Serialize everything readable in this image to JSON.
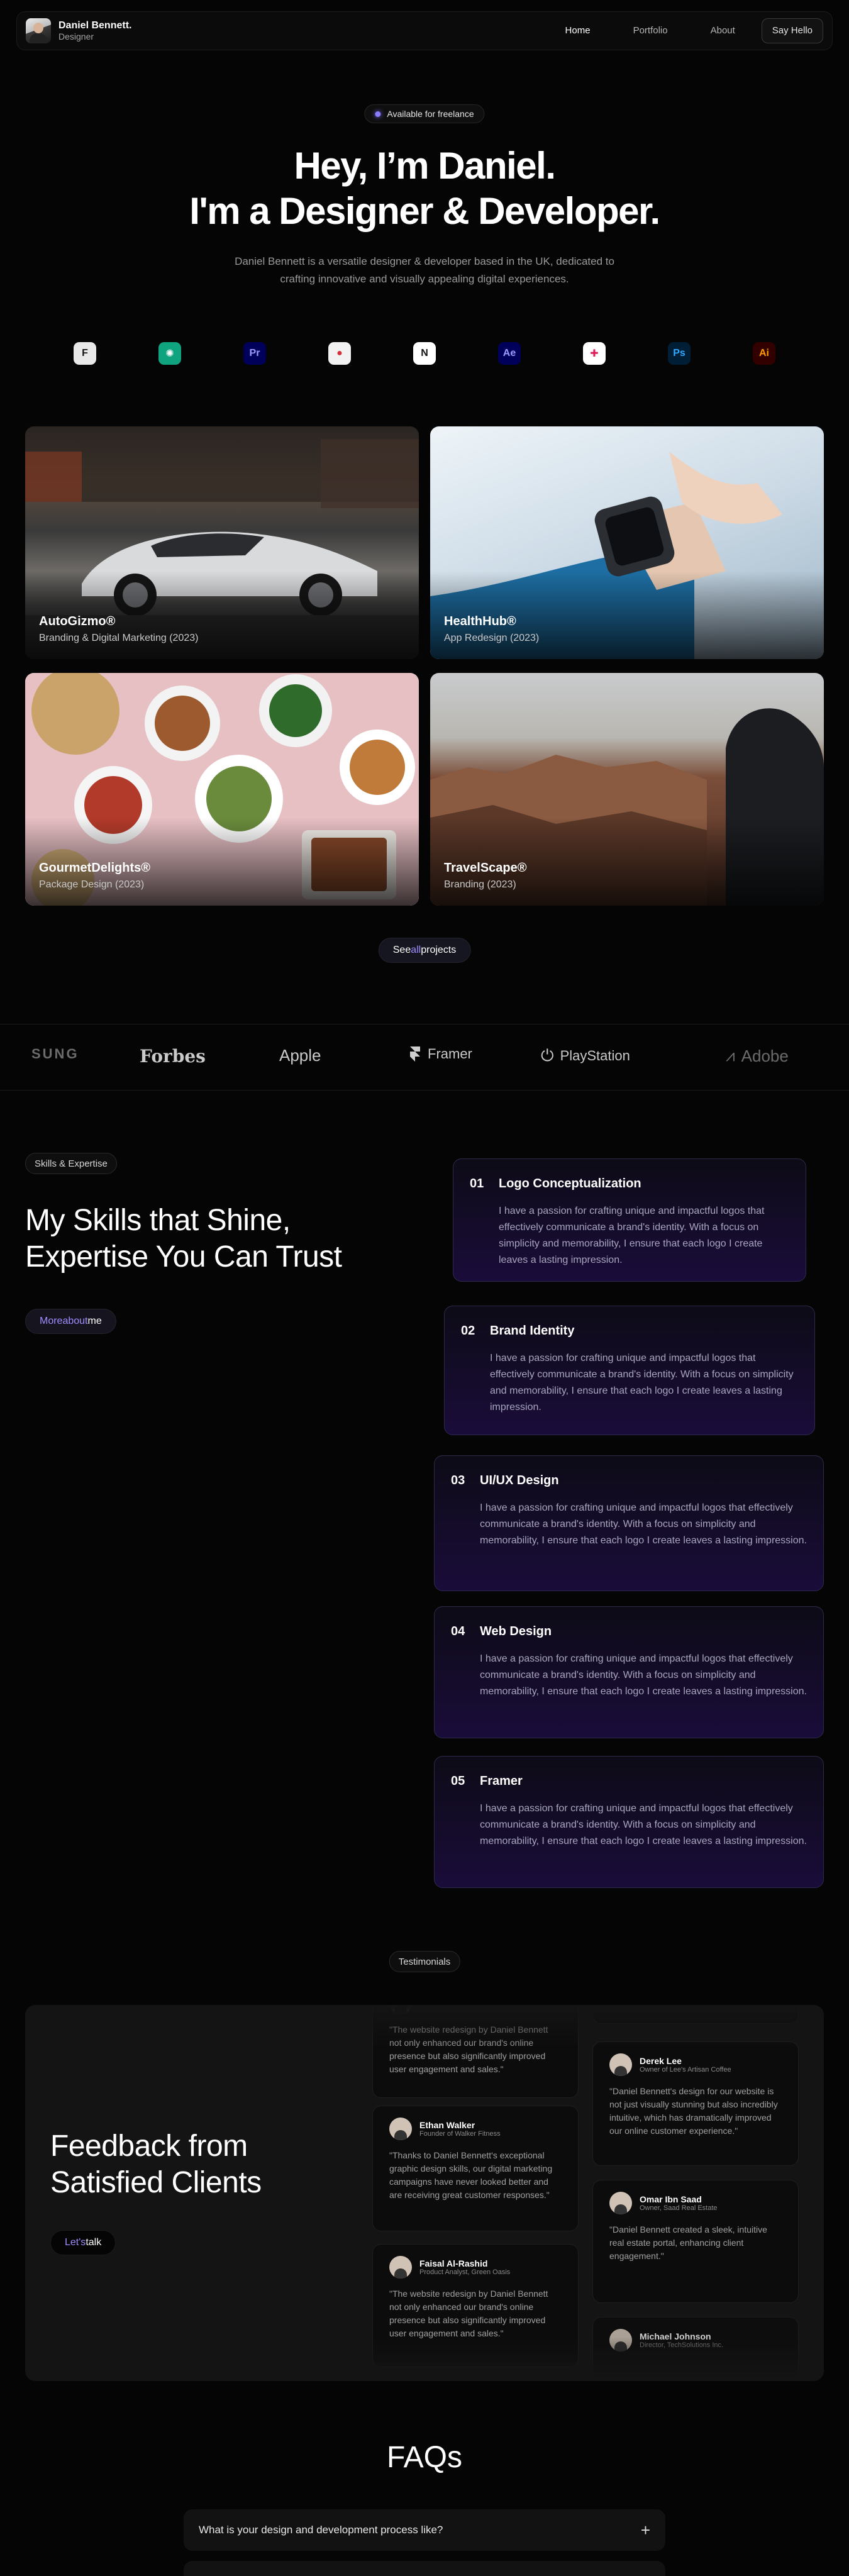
{
  "nav": {
    "brand_name": "Daniel Bennett.",
    "brand_role": "Designer",
    "links": [
      "Home",
      "Portfolio",
      "About"
    ],
    "cta": "Say Hello"
  },
  "hero": {
    "badge": "Available for freelance",
    "title_line1": "Hey, I’m Daniel.",
    "title_line2": "I'm a Designer & Developer.",
    "description": "Daniel Bennett is a versatile designer & developer based in the UK, dedicated to crafting innovative and visually appealing digital experiences."
  },
  "tools": [
    {
      "icon": "framer-icon",
      "glyph": "F",
      "bg": "#e9e9e9",
      "fg": "#111"
    },
    {
      "icon": "chatgpt-icon",
      "glyph": "✺",
      "bg": "#10a37f",
      "fg": "#fff"
    },
    {
      "icon": "premiere-icon",
      "glyph": "Pr",
      "bg": "#00005b",
      "fg": "#9999ff"
    },
    {
      "icon": "davinci-icon",
      "glyph": "●",
      "bg": "#f2f2f2",
      "fg": "#d3303a"
    },
    {
      "icon": "notion-icon",
      "glyph": "N",
      "bg": "#ffffff",
      "fg": "#111"
    },
    {
      "icon": "after-effects-icon",
      "glyph": "Ae",
      "bg": "#00005b",
      "fg": "#9999ff"
    },
    {
      "icon": "slack-icon",
      "glyph": "✚",
      "bg": "#ffffff",
      "fg": "#e01e5a"
    },
    {
      "icon": "photoshop-icon",
      "glyph": "Ps",
      "bg": "#001e36",
      "fg": "#31a8ff"
    },
    {
      "icon": "illustrator-icon",
      "glyph": "Ai",
      "bg": "#330000",
      "fg": "#ff9a00"
    }
  ],
  "projects": [
    {
      "title": "AutoGizmo®",
      "subtitle": "Branding & Digital Marketing (2023)"
    },
    {
      "title": "HealthHub®",
      "subtitle": "App Redesign (2023)"
    },
    {
      "title": "GourmetDelights®",
      "subtitle": "Package Design (2023)"
    },
    {
      "title": "TravelScape®",
      "subtitle": "Branding (2023)"
    }
  ],
  "see_all": {
    "prefix": "See ",
    "accent": "all",
    "suffix": " projects"
  },
  "logos": [
    "SUNG",
    "Forbes",
    "Apple",
    "Framer",
    "PlayStation",
    "Adobe"
  ],
  "skills": {
    "tag": "Skills & Expertise",
    "title_line1": "My Skills that Shine,",
    "title_line2": "Expertise You Can Trust",
    "cta_prefix": "More ",
    "cta_accent": "about",
    "cta_suffix": " me",
    "items": [
      {
        "num": "01",
        "name": "Logo Conceptualization",
        "desc": "I have a passion for crafting unique and impactful logos that effectively communicate a brand's identity. With a focus on simplicity and memorability, I ensure that each logo I create leaves a lasting impression."
      },
      {
        "num": "02",
        "name": "Brand Identity",
        "desc": "I have a passion for crafting unique and impactful logos that effectively communicate a brand's identity. With a focus on simplicity and memorability, I ensure that each logo I create leaves a lasting impression."
      },
      {
        "num": "03",
        "name": "UI/UX Design",
        "desc": "I have a passion for crafting unique and impactful logos that effectively communicate a brand's identity. With a focus on simplicity and memorability, I ensure that each logo I create leaves a lasting impression."
      },
      {
        "num": "04",
        "name": "Web Design",
        "desc": "I have a passion for crafting unique and impactful logos that effectively communicate a brand's identity. With a focus on simplicity and memorability, I ensure that each logo I create leaves a lasting impression."
      },
      {
        "num": "05",
        "name": "Framer",
        "desc": "I have a passion for crafting unique and impactful logos that effectively communicate a brand's identity. With a focus on simplicity and memorability, I ensure that each logo I create leaves a lasting impression."
      }
    ]
  },
  "testimonials": {
    "tag": "Testimonials",
    "title_line1": "Feedback from",
    "title_line2": "Satisfied Clients",
    "cta_prefix": "Let",
    "cta_accent": "'s",
    "cta_suffix": " talk",
    "items": [
      {
        "name": "",
        "role": "",
        "quote": "\"The website redesign by Daniel Bennett not only enhanced our brand's online presence but also significantly improved user engagement and sales.\""
      },
      {
        "name": "Ethan Walker",
        "role": "Founder of Walker Fitness",
        "quote": "\"Thanks to Daniel Bennett's exceptional graphic design skills, our digital marketing campaigns have never looked better and are receiving great customer responses.\""
      },
      {
        "name": "Faisal Al-Rashid",
        "role": "Product Analyst, Green Oasis",
        "quote": "\"The website redesign by Daniel Bennett not only enhanced our brand's online presence but also significantly improved user engagement and sales.\""
      },
      {
        "name": "Derek Lee",
        "role": "Owner of Lee's Artisan Coffee",
        "quote": "\"Daniel Bennett's design for our website is not just visually stunning but also incredibly intuitive, which has dramatically improved our online customer experience.\""
      },
      {
        "name": "Omar Ibn Saad",
        "role": "Owner, Saad Real Estate",
        "quote": "\"Daniel Bennett created a sleek, intuitive real estate portal, enhancing client engagement.\""
      },
      {
        "name": "Michael Johnson",
        "role": "Director, TechSolutions Inc.",
        "quote": ""
      }
    ]
  },
  "faq": {
    "title": "FAQs",
    "items": [
      "What is your design and development process like?"
    ]
  }
}
